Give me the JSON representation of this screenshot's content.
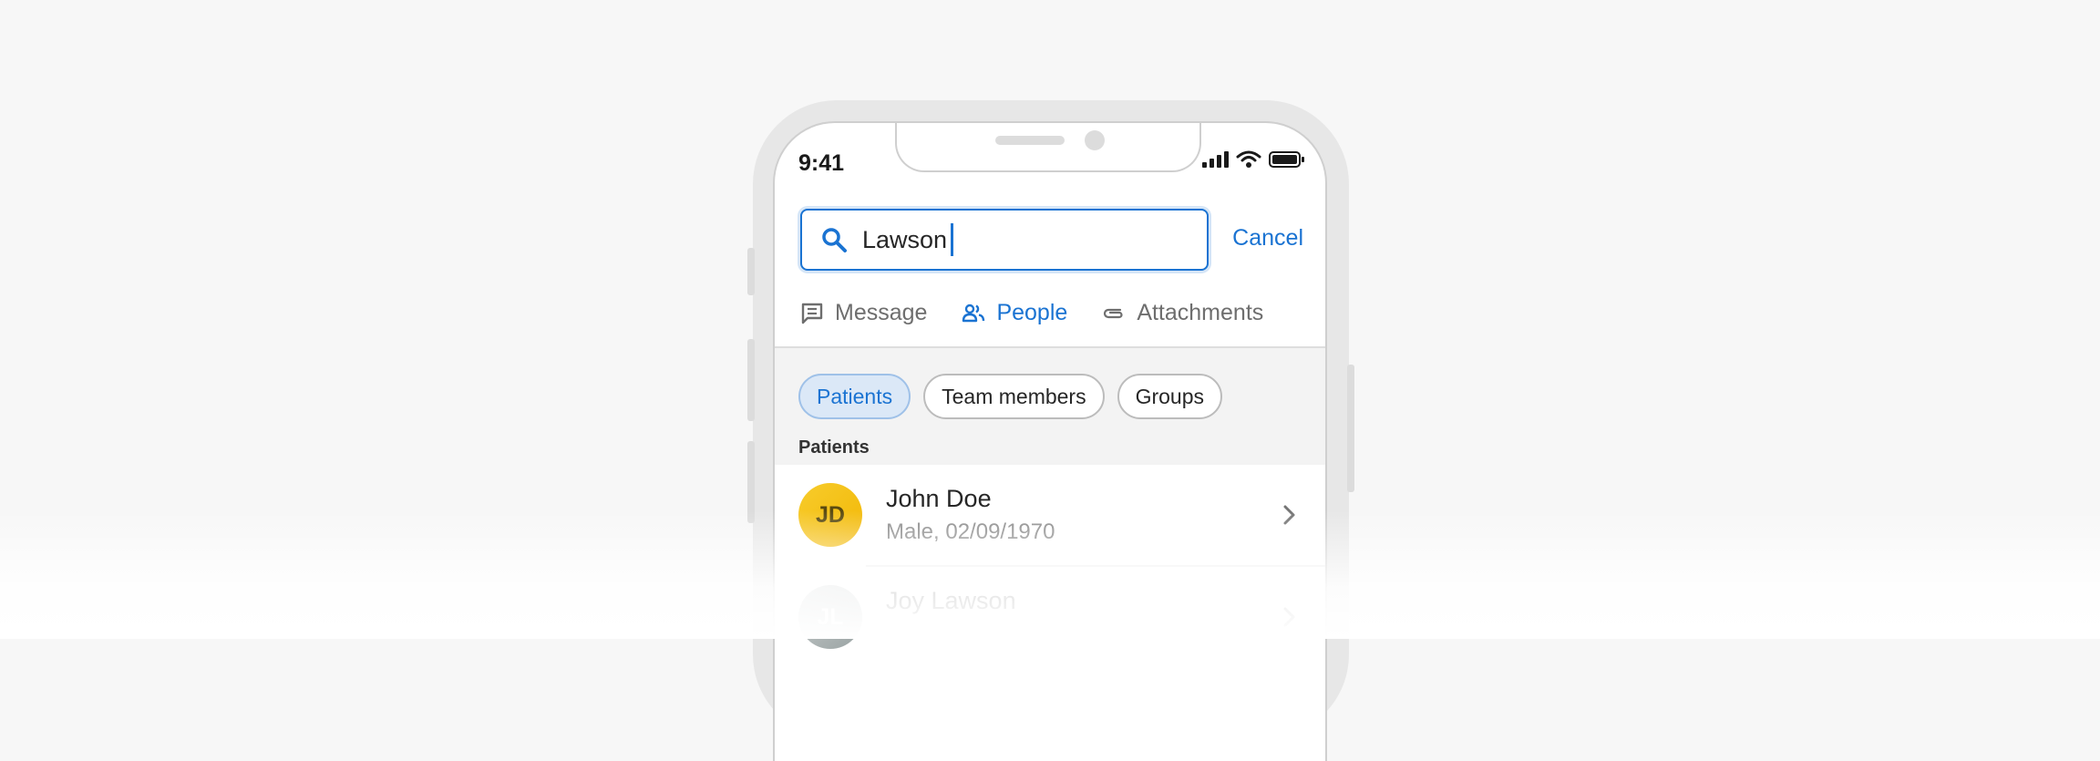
{
  "status_bar": {
    "time": "9:41"
  },
  "search": {
    "query": "Lawson",
    "cancel_label": "Cancel"
  },
  "tabs": [
    {
      "label": "Message",
      "icon": "message-icon",
      "active": false
    },
    {
      "label": "People",
      "icon": "people-icon",
      "active": true
    },
    {
      "label": "Attachments",
      "icon": "paperclip-icon",
      "active": false
    }
  ],
  "filters": {
    "chips": [
      {
        "label": "Patients",
        "selected": true
      },
      {
        "label": "Team members",
        "selected": false
      },
      {
        "label": "Groups",
        "selected": false
      }
    ],
    "section_label": "Patients"
  },
  "results": [
    {
      "initials": "JD",
      "name": "John Doe",
      "meta": "Male, 02/09/1970"
    },
    {
      "initials": "JL",
      "name": "Joy Lawson",
      "meta": ""
    }
  ],
  "colors": {
    "accent": "#1a73d2",
    "avatar_yellow": "#f5c018",
    "avatar_gray": "#b7bdbd",
    "chip_selected_bg": "#dbe8f7"
  }
}
